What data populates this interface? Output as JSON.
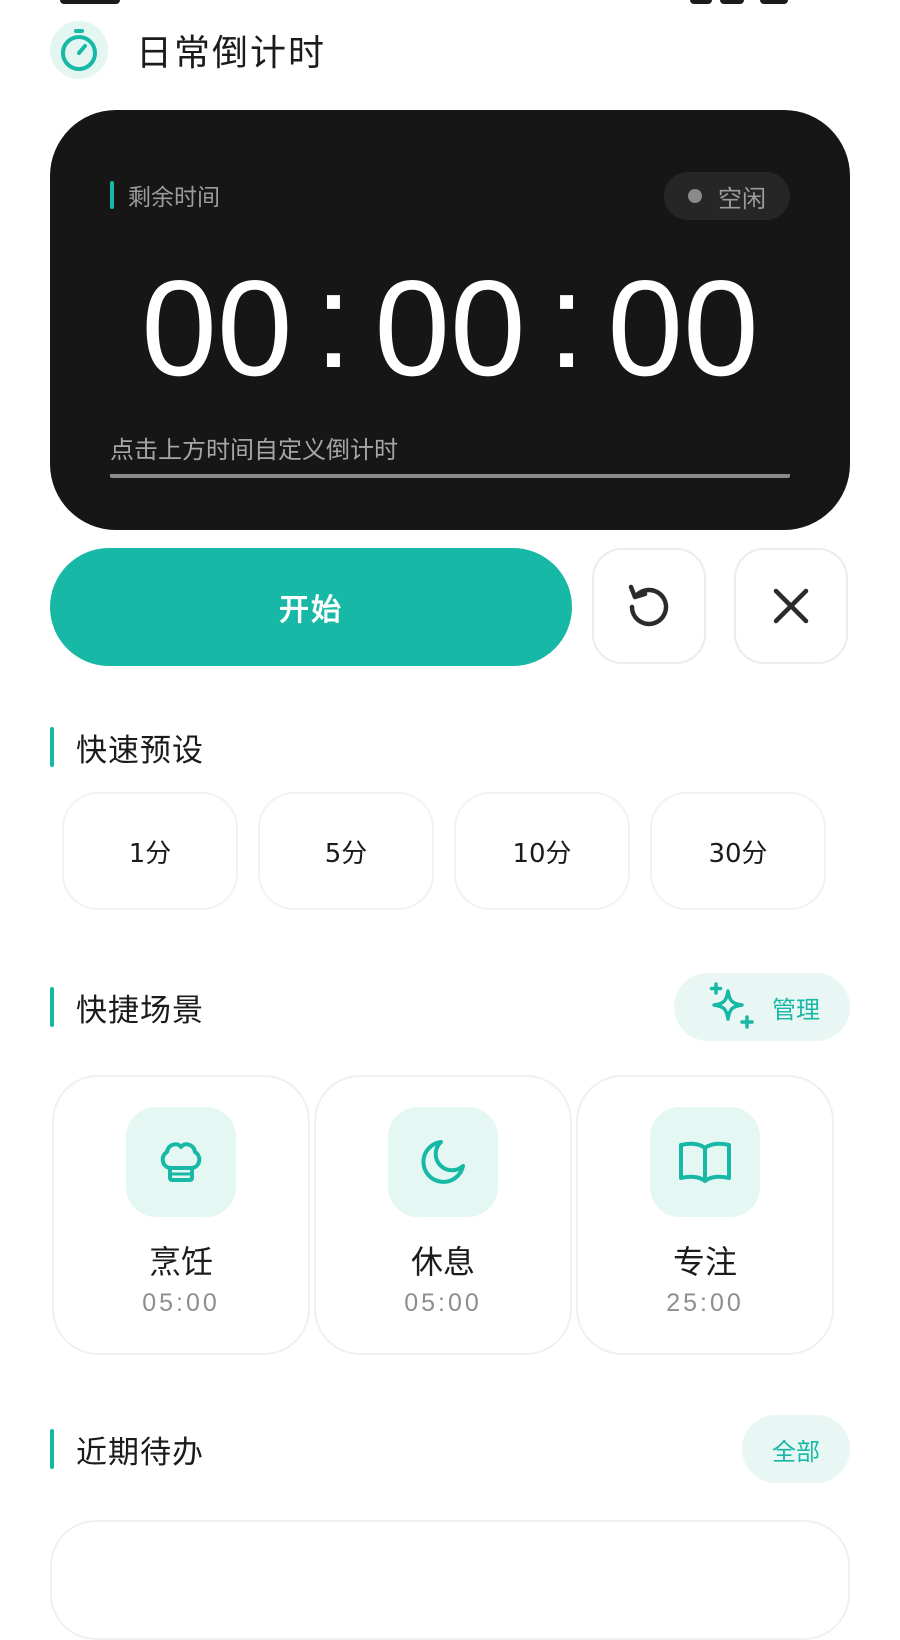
{
  "header": {
    "title": "日常倒计时",
    "logo_icon": "stopwatch-icon"
  },
  "timer": {
    "label": "剩余时间",
    "status": "空闲",
    "hours": "00",
    "minutes": "00",
    "seconds": "00",
    "separator": ":",
    "input_placeholder": "点击上方时间自定义倒计时"
  },
  "controls": {
    "start_label": "开始",
    "reset_icon": "reset-icon",
    "close_icon": "close-icon"
  },
  "presets": {
    "title": "快速预设",
    "items": [
      {
        "label": "1分"
      },
      {
        "label": "5分"
      },
      {
        "label": "10分"
      },
      {
        "label": "30分"
      }
    ]
  },
  "scenes": {
    "title": "快捷场景",
    "manage_label": "管理",
    "manage_icon": "sparkle-plus-icon",
    "items": [
      {
        "name": "烹饪",
        "duration": "05:00",
        "icon": "chef-hat-icon"
      },
      {
        "name": "休息",
        "duration": "05:00",
        "icon": "moon-icon"
      },
      {
        "name": "专注",
        "duration": "25:00",
        "icon": "book-icon"
      }
    ]
  },
  "todos": {
    "title": "近期待办",
    "all_label": "全部"
  },
  "colors": {
    "accent": "#17b8a5",
    "accent_soft": "#e4f7f3",
    "card_dark": "#161616"
  }
}
